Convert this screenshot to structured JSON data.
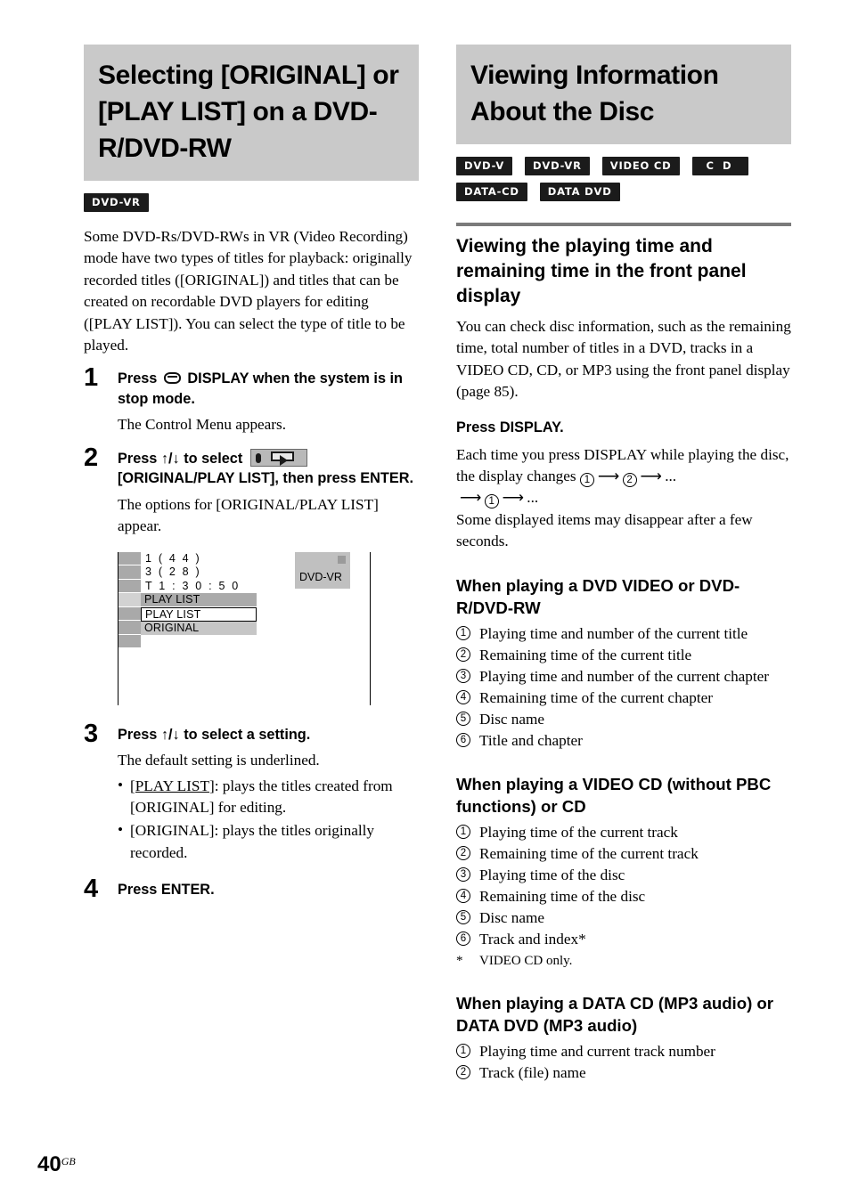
{
  "page": {
    "number": "40",
    "region_suffix": "GB"
  },
  "left_column": {
    "section_title": "Selecting [ORIGINAL] or [PLAY LIST] on a DVD-R/DVD-RW",
    "badges": [
      {
        "label": "DVD-VR",
        "style": "normal"
      }
    ],
    "intro": "Some DVD-Rs/DVD-RWs in VR (Video Recording) mode have two types of titles for playback: originally recorded titles ([ORIGINAL]) and titles that can be created on recordable DVD players for editing ([PLAY LIST]). You can select the type of title to be played.",
    "steps": [
      {
        "number": "1",
        "head_before_icon": "Press ",
        "icon": "remote-display-button-icon",
        "head_after_icon": " DISPLAY when the system is in stop mode.",
        "desc": "The Control Menu appears."
      },
      {
        "number": "2",
        "head_before_icon": "Press ↑/↓ to select ",
        "icon": "original-play-list-control-menu-icon",
        "head_after_icon": " [ORIGINAL/PLAY LIST], then press ENTER.",
        "desc": "The options for [ORIGINAL/PLAY LIST] appear."
      },
      {
        "number": "3",
        "head": "Press ↑/↓ to select a setting.",
        "desc": "The default setting is underlined.",
        "bullets": [
          {
            "term": "[PLAY LIST]",
            "underlined": true,
            "rest": ": plays the titles created from [ORIGINAL] for editing."
          },
          {
            "term": "[ORIGINAL]",
            "underlined": false,
            "rest": ": plays the titles originally recorded."
          }
        ]
      },
      {
        "number": "4",
        "head": "Press ENTER.",
        "desc": ""
      }
    ],
    "osd_figure": {
      "name": "on-screen-control-menu-figure",
      "lines": [
        "1 ( 4 4 )",
        "3 ( 2 8 )",
        "T   1 : 3 0 : 5 0"
      ],
      "current_value": "PLAY LIST",
      "options": [
        {
          "label": "PLAY LIST",
          "selected": true
        },
        {
          "label": "ORIGINAL",
          "selected": false
        }
      ],
      "disc_type": "DVD-VR"
    }
  },
  "right_column": {
    "section_title": "Viewing Information About the Disc",
    "badges": [
      {
        "label": "DVD-V",
        "style": "normal"
      },
      {
        "label": "DVD-VR",
        "style": "normal"
      },
      {
        "label": "VIDEO CD",
        "style": "normal"
      },
      {
        "label": "C D",
        "style": "wide"
      },
      {
        "label": "DATA-CD",
        "style": "normal"
      },
      {
        "label": "DATA DVD",
        "style": "normal"
      }
    ],
    "sub_head": "Viewing the playing time and remaining time in the front panel display",
    "intro": "You can check disc information, such as the remaining time, total number of titles in a DVD, tracks in a VIDEO CD, CD, or MP3 using the front panel display (page 85).",
    "press_display": "Press DISPLAY.",
    "display_cycle_text_1": "Each time you press DISPLAY while playing the disc, the display changes ",
    "display_cycle_text_2": "Some displayed items may disappear after a few seconds.",
    "cycle": {
      "first": "1",
      "second": "2",
      "ellipsis": "...",
      "repeat": "1"
    },
    "groups": [
      {
        "heading": "When playing a DVD VIDEO or DVD-R/DVD-RW",
        "items": [
          {
            "n": "1",
            "text": "Playing time and number of the current title"
          },
          {
            "n": "2",
            "text": "Remaining time of the current title"
          },
          {
            "n": "3",
            "text": "Playing time and number of the current chapter"
          },
          {
            "n": "4",
            "text": "Remaining time of the current chapter"
          },
          {
            "n": "5",
            "text": "Disc name"
          },
          {
            "n": "6",
            "text": "Title and chapter"
          }
        ],
        "footnote": ""
      },
      {
        "heading": "When playing a VIDEO CD (without PBC functions) or CD",
        "items": [
          {
            "n": "1",
            "text": "Playing time of the current track"
          },
          {
            "n": "2",
            "text": "Remaining time of the current track"
          },
          {
            "n": "3",
            "text": "Playing time of the disc"
          },
          {
            "n": "4",
            "text": "Remaining time of the disc"
          },
          {
            "n": "5",
            "text": "Disc name"
          },
          {
            "n": "6",
            "text": "Track and index*"
          }
        ],
        "footnote": "VIDEO CD only."
      },
      {
        "heading": "When playing a DATA CD (MP3 audio) or DATA DVD (MP3 audio)",
        "items": [
          {
            "n": "1",
            "text": "Playing time and current track number"
          },
          {
            "n": "2",
            "text": "Track (file) name"
          }
        ],
        "footnote": ""
      }
    ]
  },
  "colors": {
    "heading_band": "#c9c9c9",
    "badge_bg": "#1b1b1b",
    "rule": "#7b7b7b",
    "osd_bar": "#aaaaaa"
  }
}
